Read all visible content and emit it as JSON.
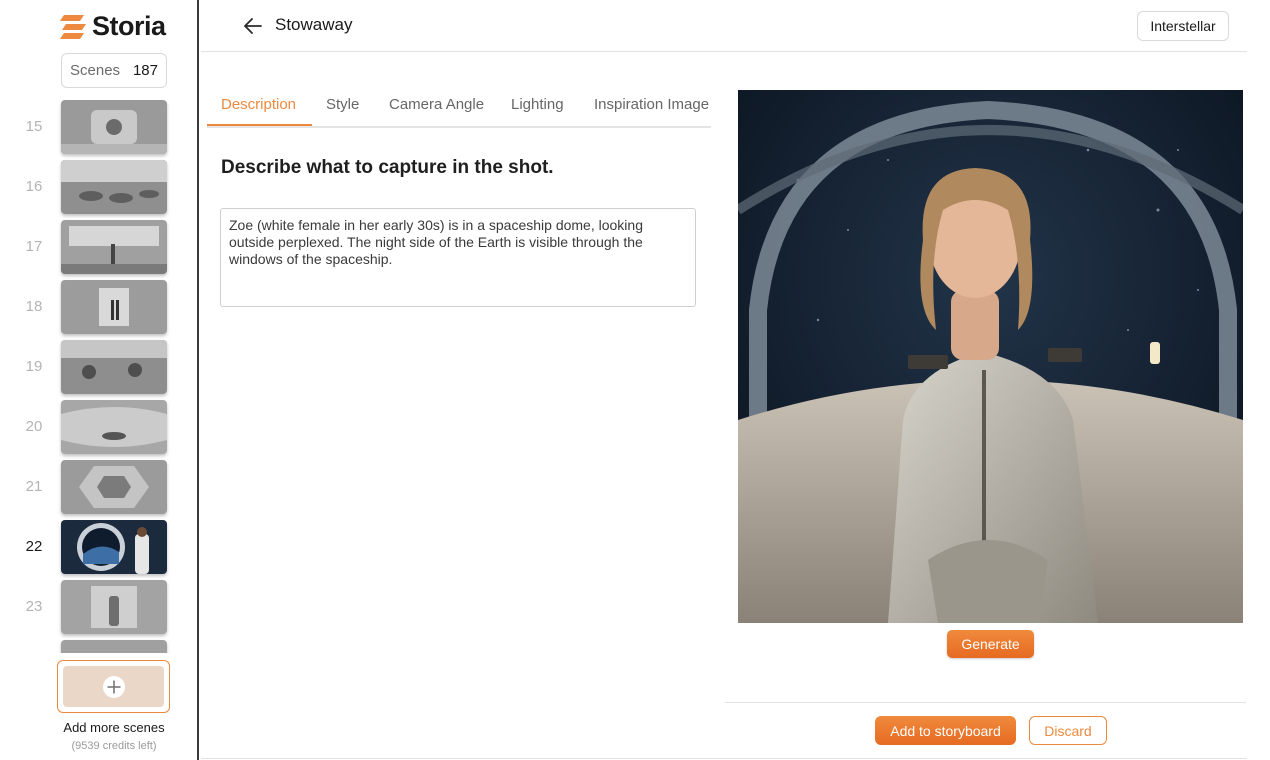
{
  "app": {
    "name": "Storia",
    "accent": "#EE8A3F"
  },
  "sidebar": {
    "scenes_label": "Scenes",
    "scenes_count": "187",
    "scenes": [
      {
        "number": "15",
        "active": false
      },
      {
        "number": "16",
        "active": false
      },
      {
        "number": "17",
        "active": false
      },
      {
        "number": "18",
        "active": false
      },
      {
        "number": "19",
        "active": false
      },
      {
        "number": "20",
        "active": false
      },
      {
        "number": "21",
        "active": false
      },
      {
        "number": "22",
        "active": true
      },
      {
        "number": "23",
        "active": false
      }
    ],
    "add_label": "Add more scenes",
    "credits": "(9539 credits left)"
  },
  "header": {
    "title": "Stowaway",
    "project": "Interstellar"
  },
  "tabs": [
    "Description",
    "Style",
    "Camera Angle",
    "Lighting",
    "Inspiration Image"
  ],
  "main": {
    "heading": "Describe what to capture in the shot.",
    "description": "Zoe (white female in her early 30s) is in a spaceship dome, looking outside perplexed. The night side of the Earth is visible through the windows of the spaceship."
  },
  "actions": {
    "generate": "Generate",
    "add_to_storyboard": "Add to storyboard",
    "discard": "Discard"
  }
}
